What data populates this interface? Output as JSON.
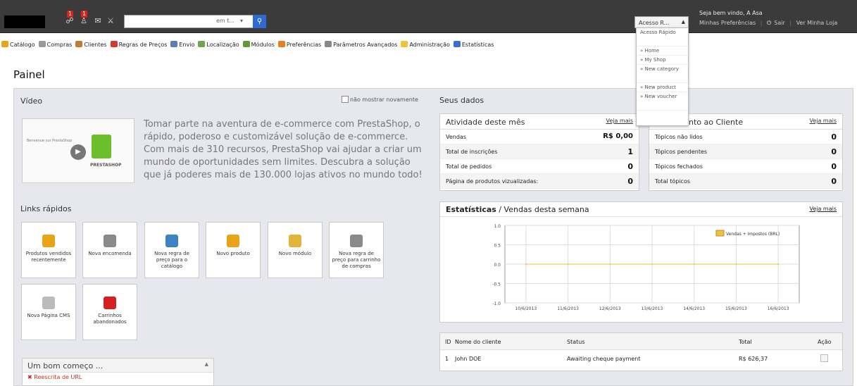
{
  "topbar": {
    "badges": [
      "1",
      "1"
    ],
    "search_option": "em t...",
    "quick_access_label": "Acesso R...",
    "welcome": "Seja bem vindo, A Asa",
    "preferences": "Minhas Preferências",
    "logout": "Sair",
    "view_store": "Ver Minha Loja"
  },
  "quick_access_menu": [
    "Acesso Rápido",
    "» Home",
    "» My Shop",
    "» New category",
    "» New product",
    "» New voucher"
  ],
  "menu": [
    {
      "label": "Catálogo",
      "color": "#e8a317"
    },
    {
      "label": "Compras",
      "color": "#999999"
    },
    {
      "label": "Clientes",
      "color": "#c07a36"
    },
    {
      "label": "Regras de Preços",
      "color": "#d33a2c"
    },
    {
      "label": "Envio",
      "color": "#5b7fb4"
    },
    {
      "label": "Localização",
      "color": "#6aa84f"
    },
    {
      "label": "Módulos",
      "color": "#5e9d31"
    },
    {
      "label": "Preferências",
      "color": "#e67e22"
    },
    {
      "label": "Parâmetros Avançados",
      "color": "#888888"
    },
    {
      "label": "Administração",
      "color": "#f1c232"
    },
    {
      "label": "Estatísticas",
      "color": "#3d6ec9"
    }
  ],
  "page_title": "Painel",
  "video": {
    "heading": "Vídeo",
    "hide_label": "não mostrar novamente",
    "thumb_text": "Benvenue sur PrestaShop",
    "brand": "PRESTASHOP",
    "intro": "Tomar parte na aventura de e-commerce com PrestaShop, o rápido, poderoso e customizável solução de e-commerce. Com mais de 310 recursos, PrestaShop vai ajudar a criar um mundo de oportunidades sem limites. Descubra a solução que já poderes mais de 130.000 lojas ativos no mundo todo!"
  },
  "quick_links": {
    "heading": "Links rápidos",
    "items": [
      {
        "label": "Produtos vendidos recentemente",
        "icon": "folder-icon",
        "color": "#e8a317"
      },
      {
        "label": "Nova encomenda",
        "icon": "cart-icon",
        "color": "#8a8a8a"
      },
      {
        "label": "Nova regra de preço para o catálogo",
        "icon": "book-icon",
        "color": "#3b83c7"
      },
      {
        "label": "Novo produto",
        "icon": "folder-add-icon",
        "color": "#e8a317"
      },
      {
        "label": "Novo módulo",
        "icon": "puzzle-icon",
        "color": "#e0b53a"
      },
      {
        "label": "Nova regra de preço para carrinho de compras",
        "icon": "cart-add-icon",
        "color": "#8a8a8a"
      },
      {
        "label": "Nova Página CMS",
        "icon": "page-add-icon",
        "color": "#bbbbbb"
      },
      {
        "label": "Carrinhos abandonados",
        "icon": "adv-icon",
        "color": "#d62020"
      }
    ]
  },
  "good_start": {
    "heading": "Um bom começo ...",
    "item": "Reescrita de URL"
  },
  "your_data": {
    "heading": "Seus dados"
  },
  "activity": {
    "heading": "Atividade deste mês",
    "more": "Veja mais",
    "rows": [
      {
        "label": "Vendas",
        "value": "R$ 0,00"
      },
      {
        "label": "Total de inscrições",
        "value": "1"
      },
      {
        "label": "Total de pedidos",
        "value": "0"
      },
      {
        "label": "Página de produtos vizualizadas:",
        "value": "0"
      }
    ]
  },
  "service": {
    "heading": "nto ao Cliente",
    "more": "Veja mais",
    "rows": [
      {
        "label": "Tópicos não lidos",
        "value": "0"
      },
      {
        "label": "Tópicos pendentes",
        "value": "0"
      },
      {
        "label": "Tópicos fechados",
        "value": "0"
      },
      {
        "label": "Total tópicos",
        "value": "0"
      }
    ]
  },
  "stats": {
    "heading_bold": "Estatísticas",
    "heading_rest": " / Vendas desta semana",
    "more": "Veja mais"
  },
  "chart_data": {
    "type": "line",
    "x": [
      "10/6/2013",
      "11/6/2013",
      "12/6/2013",
      "13/6/2013",
      "14/6/2013",
      "15/6/2013",
      "16/6/2013"
    ],
    "series": [
      {
        "name": "Vendas + Impostos (BRL)",
        "values": [
          0,
          0,
          0,
          0,
          0,
          0,
          0
        ],
        "color": "#f0c040"
      }
    ],
    "yticks": [
      "1.0",
      "0.5",
      "0.0",
      "-0.5",
      "-1.0"
    ],
    "ylim": [
      -1,
      1
    ],
    "grid": true,
    "legend": "top-right"
  },
  "orders": {
    "headers": {
      "id": "ID",
      "customer": "Nome do cliente",
      "status": "Status",
      "total": "Total",
      "action": "Ação"
    },
    "rows": [
      {
        "id": "1",
        "customer": "John DOE",
        "status": "Awaiting cheque payment",
        "total": "R$ 626,37"
      }
    ]
  }
}
